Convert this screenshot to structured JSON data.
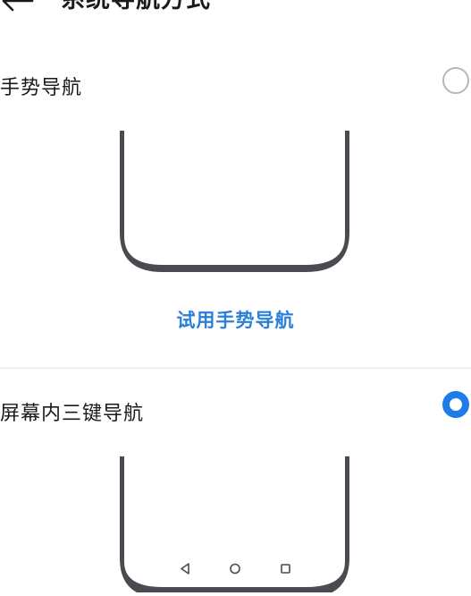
{
  "header": {
    "title": "系统导航方式",
    "back_icon": "back-arrow-icon"
  },
  "options": [
    {
      "label": "手势导航",
      "selected": false,
      "try_label": "试用手势导航"
    },
    {
      "label": "屏幕内三键导航",
      "selected": true
    }
  ],
  "colors": {
    "accent": "#1f7be8",
    "link": "#2a7fd8",
    "phone_frame": "#4a4b50",
    "radio_off": "#b8b8b8"
  },
  "nav_keys": [
    "back-triangle-icon",
    "home-circle-icon",
    "recents-square-icon"
  ]
}
